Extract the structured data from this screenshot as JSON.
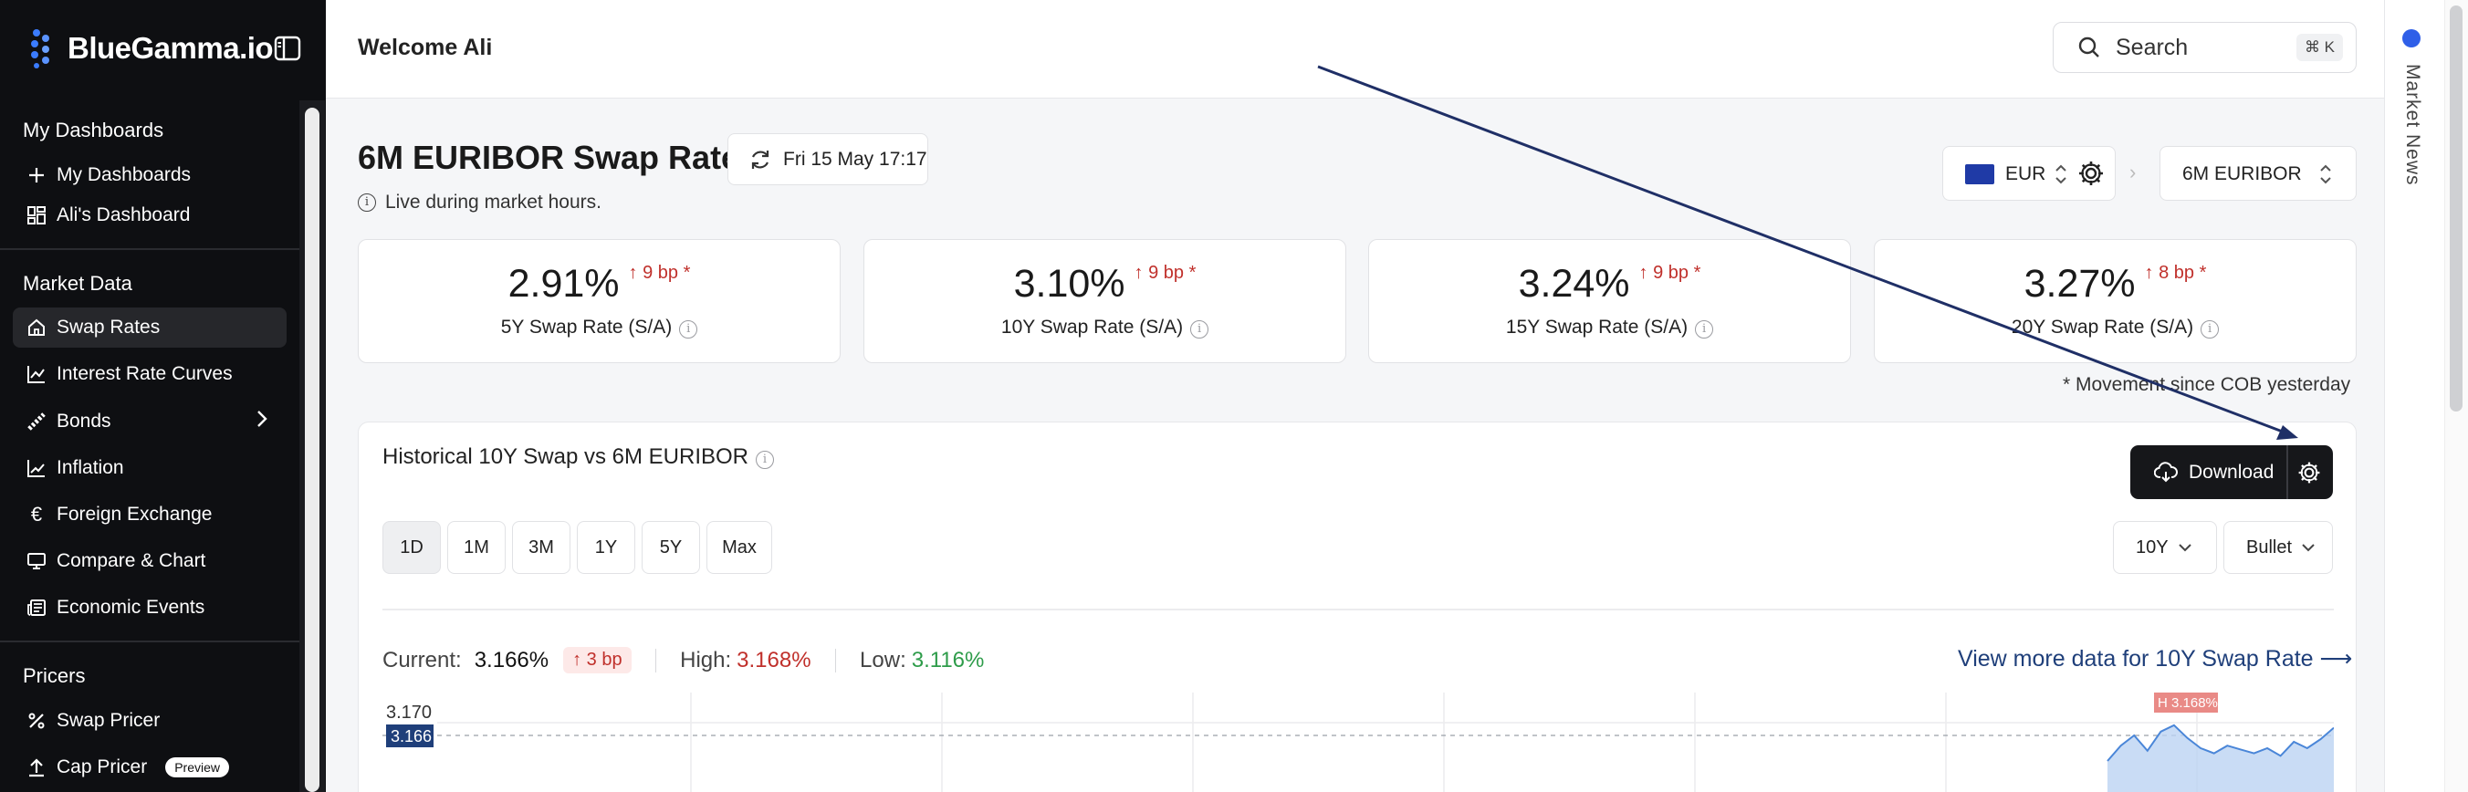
{
  "brand": {
    "name": "BlueGamma.io"
  },
  "header": {
    "welcome": "Welcome Ali",
    "search_placeholder": "Search",
    "search_shortcut": "⌘ K"
  },
  "sidebar": {
    "sections": [
      {
        "title": "My Dashboards",
        "items": [
          {
            "label": "My Dashboards",
            "icon": "plus-icon"
          },
          {
            "label": "Ali's Dashboard",
            "icon": "dashboard-icon"
          }
        ]
      },
      {
        "title": "Market Data",
        "items": [
          {
            "label": "Swap Rates",
            "icon": "home-icon",
            "active": true
          },
          {
            "label": "Interest Rate Curves",
            "icon": "chart-icon"
          },
          {
            "label": "Bonds",
            "icon": "bonds-icon"
          },
          {
            "label": "Inflation",
            "icon": "trend-icon"
          },
          {
            "label": "Foreign Exchange",
            "icon": "euro-icon"
          },
          {
            "label": "Compare & Chart",
            "icon": "monitor-icon"
          },
          {
            "label": "Economic Events",
            "icon": "newspaper-icon"
          }
        ]
      },
      {
        "title": "Pricers",
        "items": [
          {
            "label": "Swap Pricer",
            "icon": "percent-icon"
          },
          {
            "label": "Cap Pricer",
            "icon": "upload-icon",
            "badge": "Preview"
          }
        ]
      }
    ]
  },
  "main": {
    "title": "6M EURIBOR Swap Rates",
    "timestamp": "Fri 15 May 17:17",
    "live_note": "Live during market hours.",
    "currency": "EUR",
    "index": "6M EURIBOR",
    "cards": [
      {
        "value": "2.91%",
        "change": "9 bp *",
        "label": "5Y Swap Rate (S/A)"
      },
      {
        "value": "3.10%",
        "change": "9 bp *",
        "label": "10Y Swap Rate (S/A)"
      },
      {
        "value": "3.24%",
        "change": "9 bp *",
        "label": "15Y Swap Rate (S/A)"
      },
      {
        "value": "3.27%",
        "change": "8 bp *",
        "label": "20Y Swap Rate (S/A)"
      }
    ],
    "movement_note": "* Movement since COB yesterday"
  },
  "historical": {
    "title": "Historical 10Y Swap vs 6M EURIBOR",
    "download_label": "Download",
    "ranges": [
      "1D",
      "1M",
      "3M",
      "1Y",
      "5Y",
      "Max"
    ],
    "active_range": "1D",
    "tenor": "10Y",
    "style": "Bullet",
    "current_label": "Current:",
    "current_value": "3.166%",
    "current_change": "3 bp",
    "high_label": "High:",
    "high_value": "3.168%",
    "low_label": "Low:",
    "low_value": "3.116%",
    "view_more": "View more data for 10Y Swap Rate ⟶"
  },
  "chart_data": {
    "type": "area",
    "y_ticks": [
      "3.170"
    ],
    "current_marker": "3.166",
    "high_marker": "H 3.168%",
    "values": [
      3.14,
      3.152,
      3.16,
      3.148,
      3.163,
      3.168,
      3.158,
      3.15,
      3.146,
      3.152,
      3.149,
      3.146,
      3.15,
      3.144,
      3.155,
      3.15,
      3.157,
      3.166
    ],
    "ylim": [
      3.116,
      3.17
    ]
  },
  "right_panel": {
    "label": "Market News"
  },
  "colors": {
    "sidebar_bg": "#0e0f12",
    "negative": "#c0302b",
    "positive": "#2e9c4a",
    "link": "#1f3f7a",
    "accent": "#2f5fe8"
  }
}
